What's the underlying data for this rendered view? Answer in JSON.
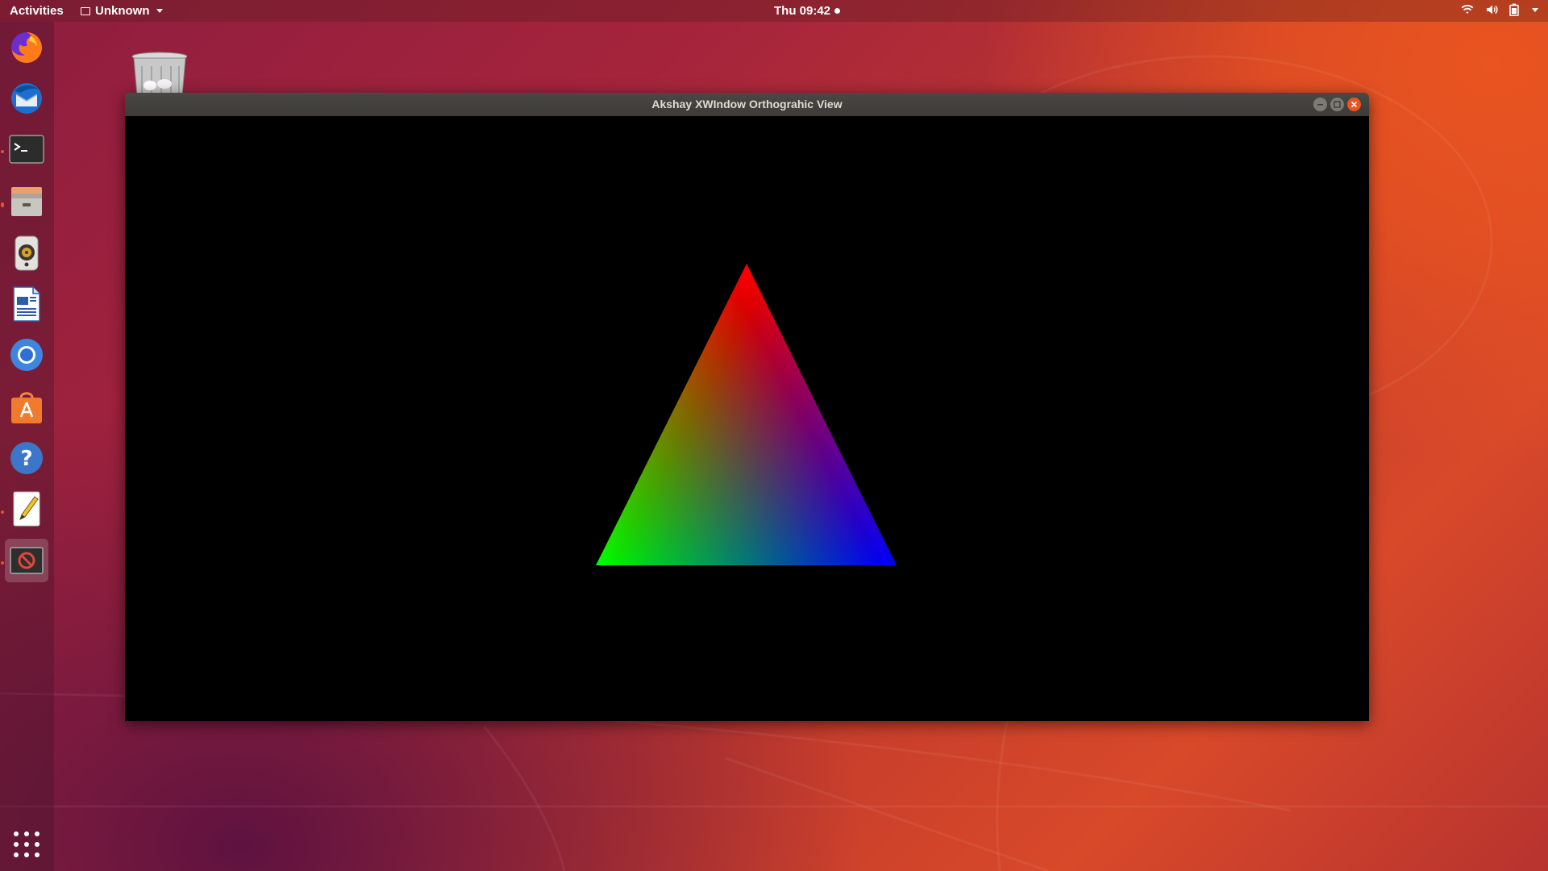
{
  "topbar": {
    "activities_label": "Activities",
    "app_menu_label": "Unknown",
    "clock": "Thu 09:42"
  },
  "tray_icons": [
    "wifi-icon",
    "volume-icon",
    "battery-icon",
    "system-menu-chevron-icon"
  ],
  "dock": {
    "items": [
      {
        "name": "firefox",
        "running": false
      },
      {
        "name": "thunderbird",
        "running": false
      },
      {
        "name": "terminal",
        "running": true
      },
      {
        "name": "files",
        "running": true
      },
      {
        "name": "rhythmbox",
        "running": false
      },
      {
        "name": "libreoffice-writer",
        "running": false
      },
      {
        "name": "chromium",
        "running": false
      },
      {
        "name": "software-center",
        "running": false
      },
      {
        "name": "help",
        "running": false
      },
      {
        "name": "text-editor",
        "running": true
      },
      {
        "name": "xwindow-app",
        "running": true,
        "active": true
      }
    ],
    "show_apps_icon": "grid-icon"
  },
  "desktop": {
    "icons": [
      "trash-icon"
    ]
  },
  "window": {
    "title": "Akshay XWIndow Orthograhic View",
    "viewport_background": "#000000",
    "triangle": {
      "vertex_colors": {
        "top": "#ff0000",
        "bottom_left": "#00ff00",
        "bottom_right": "#0000ff"
      }
    }
  },
  "colors": {
    "accent": "#e95420",
    "titlebar": "#3c3b37"
  }
}
